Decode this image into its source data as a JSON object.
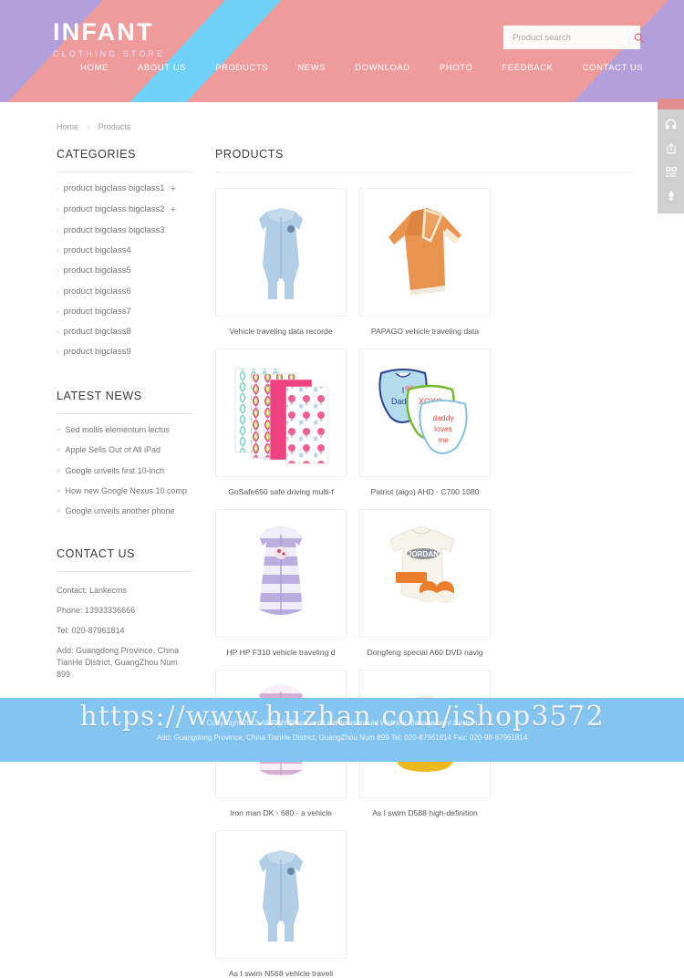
{
  "colors": {
    "header_purple": "#b29fdc",
    "header_cyan": "#6fd1f6",
    "header_salmon": "#f09b9b",
    "footer_blue": "#83c4f0",
    "accent_pink": "#e8616d",
    "toolbar_grey": "#cfcfcf"
  },
  "header": {
    "brand_title": "INFANT",
    "brand_subtitle": "CLOTHING STORE",
    "nav": [
      {
        "label": "HOME"
      },
      {
        "label": "ABOUT US"
      },
      {
        "label": "PRODUCTS"
      },
      {
        "label": "NEWS"
      },
      {
        "label": "DOWNLOAD"
      },
      {
        "label": "PHOTO"
      },
      {
        "label": "FEEDBACK"
      },
      {
        "label": "CONTACT US"
      }
    ],
    "search": {
      "placeholder": "Product search",
      "value": "",
      "icon": "search-icon"
    }
  },
  "side_toolbar": {
    "buttons": [
      {
        "icon": "headset-icon",
        "name": "customer-service"
      },
      {
        "icon": "share-icon",
        "name": "share"
      },
      {
        "icon": "qrcode-list-icon",
        "name": "qr-list"
      },
      {
        "icon": "rocket-icon",
        "name": "back-to-top"
      }
    ]
  },
  "breadcrumb": {
    "home": "Home",
    "separator": "›",
    "current": "Products"
  },
  "sidebar": {
    "categories_heading": "CATEGORIES",
    "categories": [
      {
        "label": "product bigclass bigclass1",
        "expandable": "+"
      },
      {
        "label": "product bigclass bigclass2",
        "expandable": "+"
      },
      {
        "label": "product bigclass bigclass3",
        "expandable": ""
      },
      {
        "label": "product bigclass4",
        "expandable": ""
      },
      {
        "label": "product bigclass5",
        "expandable": ""
      },
      {
        "label": "product bigclass6",
        "expandable": ""
      },
      {
        "label": "product bigclass7",
        "expandable": ""
      },
      {
        "label": "product bigclass8",
        "expandable": ""
      },
      {
        "label": "product bigclass9",
        "expandable": ""
      }
    ],
    "news_heading": "LATEST NEWS",
    "news": [
      {
        "label": "Sed mollis elementum lectus"
      },
      {
        "label": "Apple Sells Out of All iPad"
      },
      {
        "label": "Google unveils first 10-inch"
      },
      {
        "label": "How new Google Nexus 10 comp"
      },
      {
        "label": "Google unveils another phone"
      }
    ],
    "contact_heading": "CONTACT US",
    "contact_lines": [
      {
        "text": "Contact: Lankecms"
      },
      {
        "text": "Phone: 13933336666"
      },
      {
        "text": "Tel: 020-87961814"
      },
      {
        "text": "Add: Guangdong Province, China TianHe District, GuangZhou Num 899"
      }
    ]
  },
  "main": {
    "heading": "PRODUCTS",
    "products": [
      {
        "title": "Vehicle traveling data recorde",
        "art": "sleepsack-blue-legs"
      },
      {
        "title": "PAPAGO vehicle traveling data",
        "art": "gown-orange"
      },
      {
        "title": "GoSafe650 safe driving multi-f",
        "art": "blanket-stack"
      },
      {
        "title": "Patriot (aigo) AHD - C700 1080",
        "art": "bibs-set"
      },
      {
        "title": "HP HP F310 vehicle traveling d",
        "art": "sleepsack-purple-stripe"
      },
      {
        "title": "Dongfeng special A60 DVD navig",
        "art": "onesie-giftset"
      },
      {
        "title": "Iron man DK - 680 - a vehicle",
        "art": "sleepsack-pink-stripe"
      },
      {
        "title": "As I swim D588 high-definition",
        "art": "bib-yellow"
      },
      {
        "title": "As I swim N568 vehicle traveli",
        "art": "sleepsack-blue-legs"
      }
    ]
  },
  "footer": {
    "line1": "CopyRight 2013 All Right Reserved Lankecms mould Website Management System",
    "line2": "Add: Guangdong Province, China TianHe District, GuangZhou Num 899  Tel: 020-87961814  Fax: 020-98-87961814"
  },
  "watermark": {
    "text": "https://www.huzhan.com/ishop3572"
  }
}
